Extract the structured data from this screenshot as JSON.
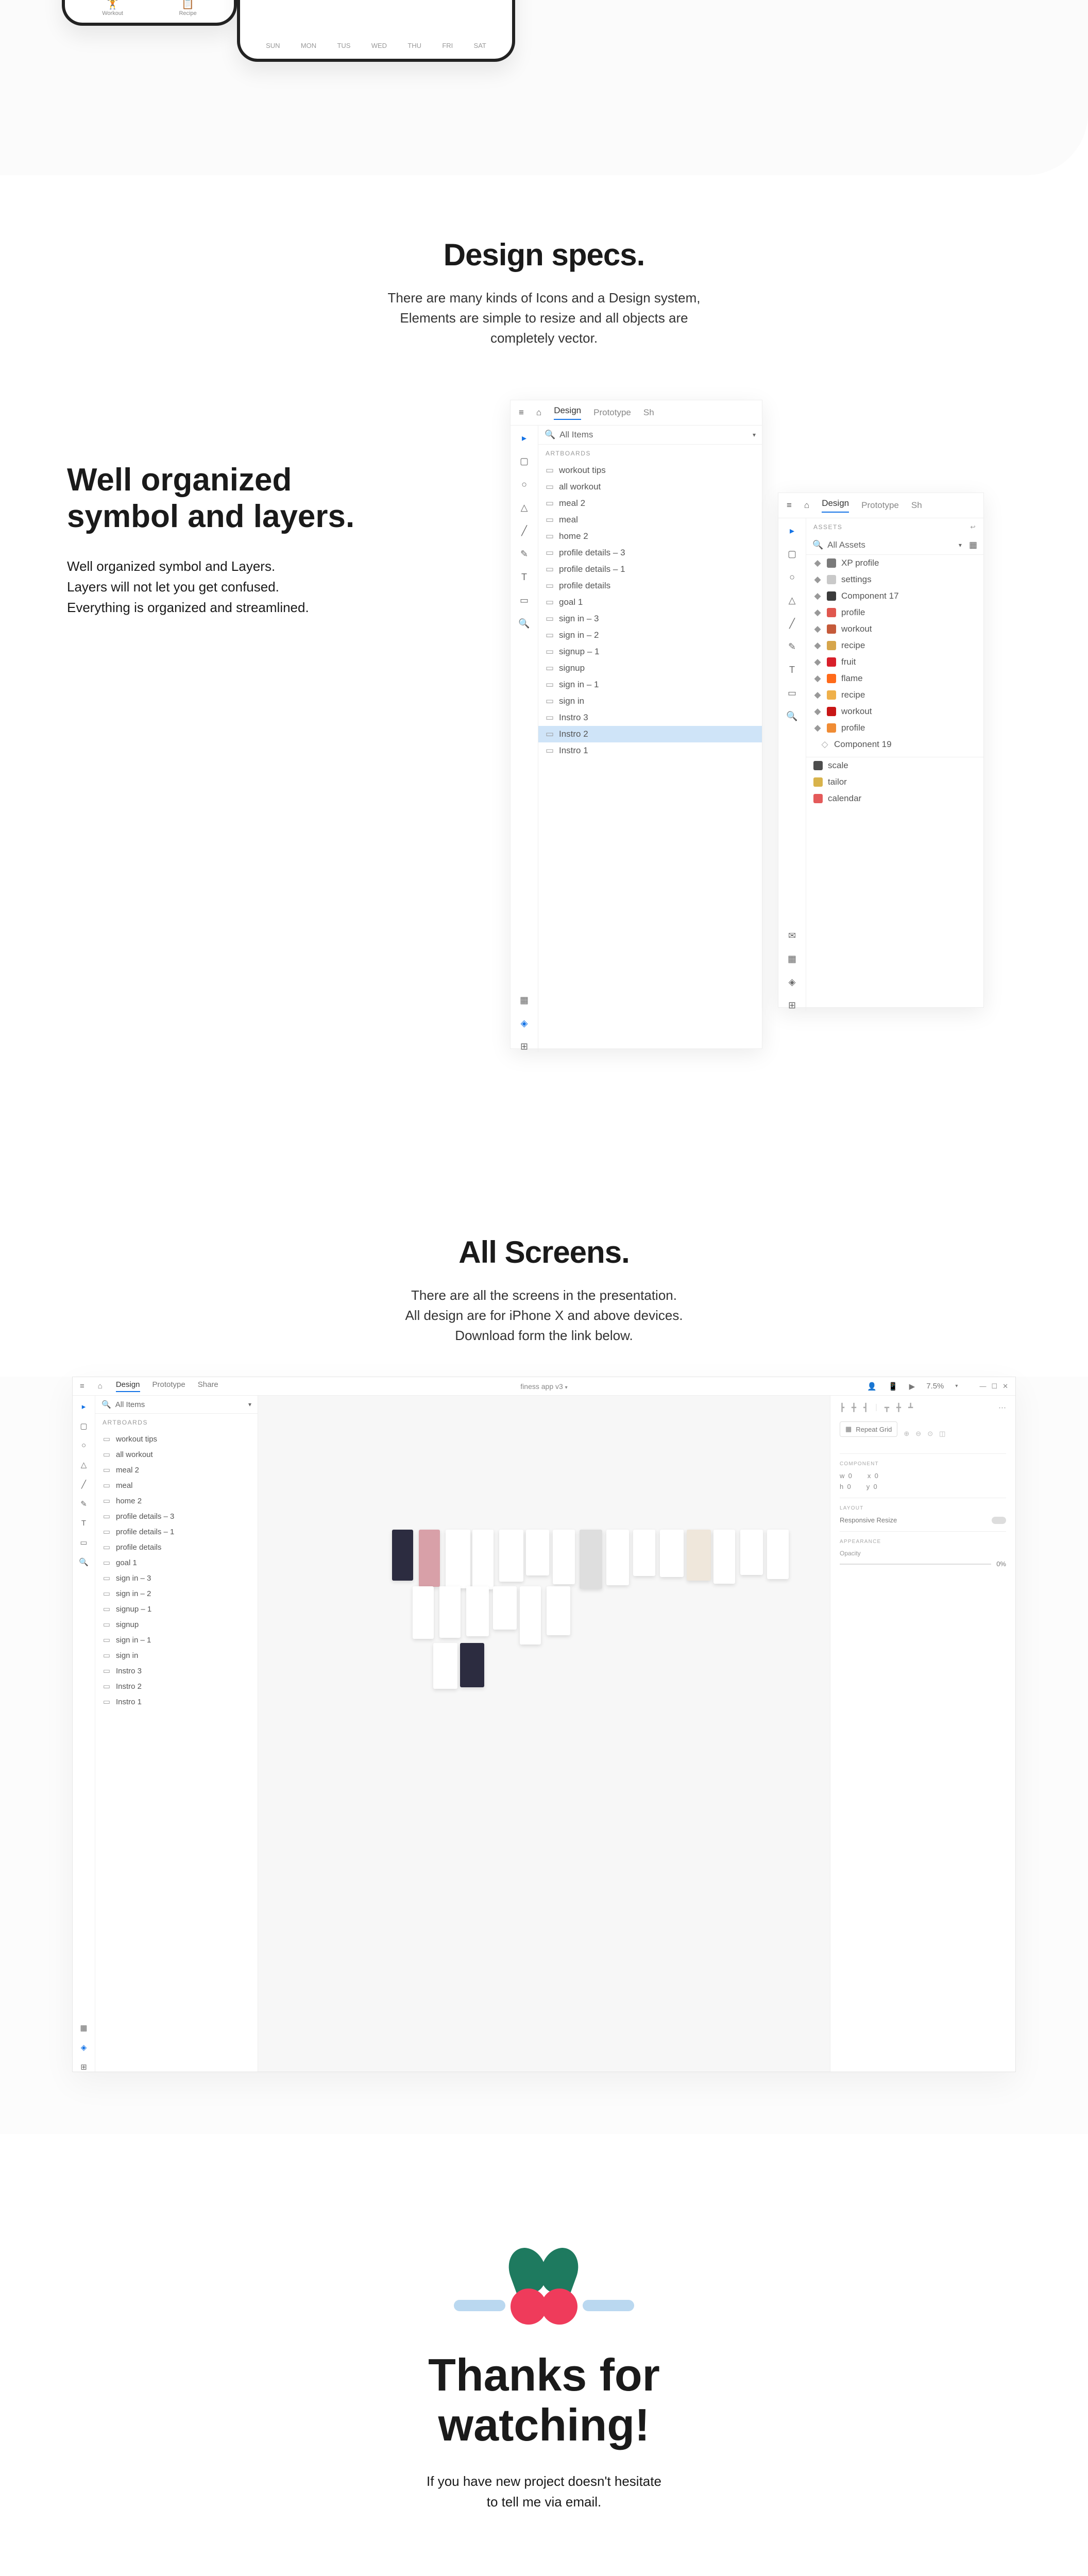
{
  "hero": {
    "smallPhone": {
      "tabs": [
        {
          "icon": "🏋️",
          "label": "Workout"
        },
        {
          "icon": "📋",
          "label": "Recipe"
        }
      ]
    },
    "bigPhone": {
      "days": [
        "SUN",
        "MON",
        "TUS",
        "WED",
        "THU",
        "FRI",
        "SAT"
      ]
    }
  },
  "specs": {
    "title": "Design specs.",
    "l1": "There are many kinds of Icons and a Design system,",
    "l2": "Elements are simple to resize and all objects are",
    "l3": "completely vector."
  },
  "layers": {
    "title1": "Well organized",
    "title2": "symbol and layers.",
    "p1": "Well organized symbol and Layers.",
    "p2": "Layers will not let you get confused.",
    "p3": "Everything is organized and streamlined."
  },
  "panelA": {
    "tabs": {
      "design": "Design",
      "prototype": "Prototype",
      "share": "Sh"
    },
    "search": "All Items",
    "section": "ARTBOARDS",
    "items": [
      "workout tips",
      "all workout",
      "meal 2",
      "meal",
      "home 2",
      "profile details – 3",
      "profile details – 1",
      "profile details",
      "goal 1",
      "sign in – 3",
      "sign in – 2",
      "signup – 1",
      "signup",
      "sign in – 1",
      "sign in",
      "Instro 3",
      "Instro 2",
      "Instro 1"
    ],
    "selected": "Instro 2"
  },
  "panelB": {
    "tabs": {
      "design": "Design",
      "prototype": "Prototype",
      "share": "Sh"
    },
    "assetsLabel": "ASSETS",
    "search": "All Assets",
    "items": [
      {
        "c": "#7a7a7a",
        "t": "XP profile"
      },
      {
        "c": "#c9c9c9",
        "t": "settings"
      },
      {
        "c": "#3b3b3b",
        "t": "Component 17"
      },
      {
        "c": "#e0574e",
        "t": "profile"
      },
      {
        "c": "#c55a3a",
        "t": "workout"
      },
      {
        "c": "#d6a54b",
        "t": "recipe"
      },
      {
        "c": "#d81f2a",
        "t": "fruit"
      },
      {
        "c": "#ff6a1a",
        "t": "flame"
      },
      {
        "c": "#efb04a",
        "t": "recipe"
      },
      {
        "c": "#c81616",
        "t": "workout"
      },
      {
        "c": "#f08c34",
        "t": "profile"
      }
    ],
    "componentLabel": "Component 19",
    "bottom": [
      {
        "c": "#4d4d4d",
        "t": "scale"
      },
      {
        "c": "#d8b34b",
        "t": "tailor"
      },
      {
        "c": "#e45a5a",
        "t": "calendar"
      }
    ]
  },
  "allscreens": {
    "title": "All Screens.",
    "l1": "There are all the screens in the presentation.",
    "l2": "All design are for iPhone X and above devices.",
    "l3": "Download form the link below."
  },
  "fullwin": {
    "tabs": {
      "design": "Design",
      "prototype": "Prototype",
      "share": "Share"
    },
    "docTitle": "finess app v3",
    "zoom": "7.5%",
    "search": "All Items",
    "section": "ARTBOARDS",
    "items": [
      "workout tips",
      "all workout",
      "meal 2",
      "meal",
      "home 2",
      "profile details – 3",
      "profile details – 1",
      "profile details",
      "goal 1",
      "sign in – 3",
      "sign in – 2",
      "signup – 1",
      "signup",
      "sign in – 1",
      "sign in",
      "Instro 3",
      "Instro 2",
      "Instro 1"
    ],
    "right": {
      "repeat": "Repeat Grid",
      "component": "COMPONENT",
      "w": "w",
      "wval": "0",
      "x": "x",
      "xval": "0",
      "h": "h",
      "hval": "0",
      "y": "y",
      "yval": "0",
      "layout": "LAYOUT",
      "responsive": "Responsive Resize",
      "appearance": "APPEARANCE",
      "opacity": "Opacity",
      "opacityVal": "0%"
    }
  },
  "thanks": {
    "t1": "Thanks for",
    "t2": "watching!",
    "p1": "If you have new project doesn't hesitate",
    "p2": "to tell me via email."
  }
}
